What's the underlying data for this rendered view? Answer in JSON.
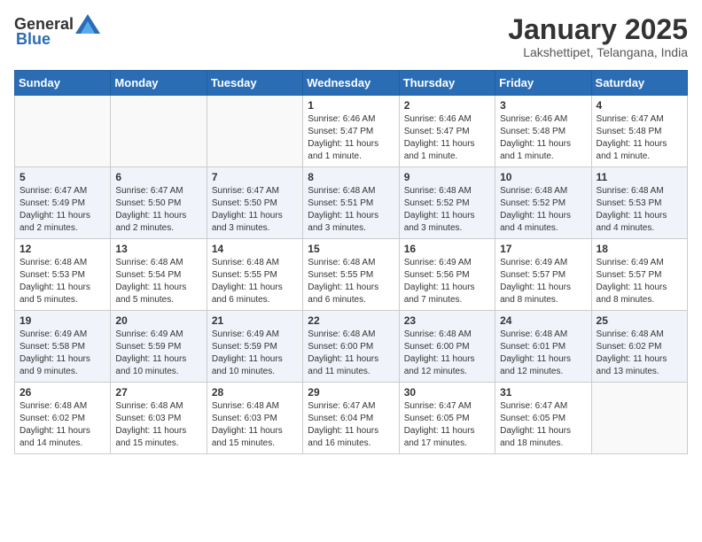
{
  "header": {
    "logo_general": "General",
    "logo_blue": "Blue",
    "month_title": "January 2025",
    "location": "Lakshettipet, Telangana, India"
  },
  "days_of_week": [
    "Sunday",
    "Monday",
    "Tuesday",
    "Wednesday",
    "Thursday",
    "Friday",
    "Saturday"
  ],
  "weeks": [
    [
      {
        "day": "",
        "info": ""
      },
      {
        "day": "",
        "info": ""
      },
      {
        "day": "",
        "info": ""
      },
      {
        "day": "1",
        "info": "Sunrise: 6:46 AM\nSunset: 5:47 PM\nDaylight: 11 hours\nand 1 minute."
      },
      {
        "day": "2",
        "info": "Sunrise: 6:46 AM\nSunset: 5:47 PM\nDaylight: 11 hours\nand 1 minute."
      },
      {
        "day": "3",
        "info": "Sunrise: 6:46 AM\nSunset: 5:48 PM\nDaylight: 11 hours\nand 1 minute."
      },
      {
        "day": "4",
        "info": "Sunrise: 6:47 AM\nSunset: 5:48 PM\nDaylight: 11 hours\nand 1 minute."
      }
    ],
    [
      {
        "day": "5",
        "info": "Sunrise: 6:47 AM\nSunset: 5:49 PM\nDaylight: 11 hours\nand 2 minutes."
      },
      {
        "day": "6",
        "info": "Sunrise: 6:47 AM\nSunset: 5:50 PM\nDaylight: 11 hours\nand 2 minutes."
      },
      {
        "day": "7",
        "info": "Sunrise: 6:47 AM\nSunset: 5:50 PM\nDaylight: 11 hours\nand 3 minutes."
      },
      {
        "day": "8",
        "info": "Sunrise: 6:48 AM\nSunset: 5:51 PM\nDaylight: 11 hours\nand 3 minutes."
      },
      {
        "day": "9",
        "info": "Sunrise: 6:48 AM\nSunset: 5:52 PM\nDaylight: 11 hours\nand 3 minutes."
      },
      {
        "day": "10",
        "info": "Sunrise: 6:48 AM\nSunset: 5:52 PM\nDaylight: 11 hours\nand 4 minutes."
      },
      {
        "day": "11",
        "info": "Sunrise: 6:48 AM\nSunset: 5:53 PM\nDaylight: 11 hours\nand 4 minutes."
      }
    ],
    [
      {
        "day": "12",
        "info": "Sunrise: 6:48 AM\nSunset: 5:53 PM\nDaylight: 11 hours\nand 5 minutes."
      },
      {
        "day": "13",
        "info": "Sunrise: 6:48 AM\nSunset: 5:54 PM\nDaylight: 11 hours\nand 5 minutes."
      },
      {
        "day": "14",
        "info": "Sunrise: 6:48 AM\nSunset: 5:55 PM\nDaylight: 11 hours\nand 6 minutes."
      },
      {
        "day": "15",
        "info": "Sunrise: 6:48 AM\nSunset: 5:55 PM\nDaylight: 11 hours\nand 6 minutes."
      },
      {
        "day": "16",
        "info": "Sunrise: 6:49 AM\nSunset: 5:56 PM\nDaylight: 11 hours\nand 7 minutes."
      },
      {
        "day": "17",
        "info": "Sunrise: 6:49 AM\nSunset: 5:57 PM\nDaylight: 11 hours\nand 8 minutes."
      },
      {
        "day": "18",
        "info": "Sunrise: 6:49 AM\nSunset: 5:57 PM\nDaylight: 11 hours\nand 8 minutes."
      }
    ],
    [
      {
        "day": "19",
        "info": "Sunrise: 6:49 AM\nSunset: 5:58 PM\nDaylight: 11 hours\nand 9 minutes."
      },
      {
        "day": "20",
        "info": "Sunrise: 6:49 AM\nSunset: 5:59 PM\nDaylight: 11 hours\nand 10 minutes."
      },
      {
        "day": "21",
        "info": "Sunrise: 6:49 AM\nSunset: 5:59 PM\nDaylight: 11 hours\nand 10 minutes."
      },
      {
        "day": "22",
        "info": "Sunrise: 6:48 AM\nSunset: 6:00 PM\nDaylight: 11 hours\nand 11 minutes."
      },
      {
        "day": "23",
        "info": "Sunrise: 6:48 AM\nSunset: 6:00 PM\nDaylight: 11 hours\nand 12 minutes."
      },
      {
        "day": "24",
        "info": "Sunrise: 6:48 AM\nSunset: 6:01 PM\nDaylight: 11 hours\nand 12 minutes."
      },
      {
        "day": "25",
        "info": "Sunrise: 6:48 AM\nSunset: 6:02 PM\nDaylight: 11 hours\nand 13 minutes."
      }
    ],
    [
      {
        "day": "26",
        "info": "Sunrise: 6:48 AM\nSunset: 6:02 PM\nDaylight: 11 hours\nand 14 minutes."
      },
      {
        "day": "27",
        "info": "Sunrise: 6:48 AM\nSunset: 6:03 PM\nDaylight: 11 hours\nand 15 minutes."
      },
      {
        "day": "28",
        "info": "Sunrise: 6:48 AM\nSunset: 6:03 PM\nDaylight: 11 hours\nand 15 minutes."
      },
      {
        "day": "29",
        "info": "Sunrise: 6:47 AM\nSunset: 6:04 PM\nDaylight: 11 hours\nand 16 minutes."
      },
      {
        "day": "30",
        "info": "Sunrise: 6:47 AM\nSunset: 6:05 PM\nDaylight: 11 hours\nand 17 minutes."
      },
      {
        "day": "31",
        "info": "Sunrise: 6:47 AM\nSunset: 6:05 PM\nDaylight: 11 hours\nand 18 minutes."
      },
      {
        "day": "",
        "info": ""
      }
    ]
  ]
}
